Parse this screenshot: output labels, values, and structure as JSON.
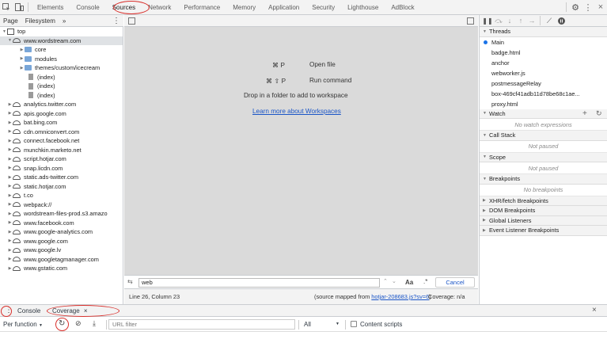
{
  "main_tabs": [
    "Elements",
    "Console",
    "Sources",
    "Network",
    "Performance",
    "Memory",
    "Application",
    "Security",
    "Lighthouse",
    "AdBlock"
  ],
  "navigator": {
    "tabs": [
      "Page",
      "Filesystem",
      "»"
    ],
    "tree": [
      {
        "label": "top",
        "indent": 0,
        "kind": "frame",
        "open": true
      },
      {
        "label": "www.wordstream.com",
        "indent": 1,
        "kind": "cloud",
        "open": true,
        "selected": true
      },
      {
        "label": "core",
        "indent": 2,
        "kind": "folder",
        "open": false
      },
      {
        "label": "modules",
        "indent": 2,
        "kind": "folder",
        "open": false
      },
      {
        "label": "themes/custom/icecream",
        "indent": 2,
        "kind": "folder",
        "open": false
      },
      {
        "label": "(index)",
        "indent": 3,
        "kind": "file"
      },
      {
        "label": "(index)",
        "indent": 3,
        "kind": "file"
      },
      {
        "label": "(index)",
        "indent": 3,
        "kind": "file"
      },
      {
        "label": "analytics.twitter.com",
        "indent": 1,
        "kind": "cloud",
        "open": false
      },
      {
        "label": "apis.google.com",
        "indent": 1,
        "kind": "cloud",
        "open": false
      },
      {
        "label": "bat.bing.com",
        "indent": 1,
        "kind": "cloud",
        "open": false
      },
      {
        "label": "cdn.omniconvert.com",
        "indent": 1,
        "kind": "cloud",
        "open": false
      },
      {
        "label": "connect.facebook.net",
        "indent": 1,
        "kind": "cloud",
        "open": false
      },
      {
        "label": "munchkin.marketo.net",
        "indent": 1,
        "kind": "cloud",
        "open": false
      },
      {
        "label": "script.hotjar.com",
        "indent": 1,
        "kind": "cloud",
        "open": false
      },
      {
        "label": "snap.licdn.com",
        "indent": 1,
        "kind": "cloud",
        "open": false
      },
      {
        "label": "static.ads-twitter.com",
        "indent": 1,
        "kind": "cloud",
        "open": false
      },
      {
        "label": "static.hotjar.com",
        "indent": 1,
        "kind": "cloud",
        "open": false
      },
      {
        "label": "t.co",
        "indent": 1,
        "kind": "cloud",
        "open": false
      },
      {
        "label": "webpack://",
        "indent": 1,
        "kind": "cloud",
        "open": false
      },
      {
        "label": "wordstream-files-prod.s3.amazo",
        "indent": 1,
        "kind": "cloud",
        "open": false
      },
      {
        "label": "www.facebook.com",
        "indent": 1,
        "kind": "cloud",
        "open": false
      },
      {
        "label": "www.google-analytics.com",
        "indent": 1,
        "kind": "cloud",
        "open": false
      },
      {
        "label": "www.google.com",
        "indent": 1,
        "kind": "cloud",
        "open": false
      },
      {
        "label": "www.google.lv",
        "indent": 1,
        "kind": "cloud",
        "open": false
      },
      {
        "label": "www.googletagmanager.com",
        "indent": 1,
        "kind": "cloud",
        "open": false
      },
      {
        "label": "www.gstatic.com",
        "indent": 1,
        "kind": "cloud",
        "open": false
      }
    ]
  },
  "editor": {
    "open_file_keys": "⌘ P",
    "open_file_label": "Open file",
    "run_command_keys": "⌘ ⇧ P",
    "run_command_label": "Run command",
    "drop_folder_text": "Drop in a folder to add to workspace",
    "workspaces_link": "Learn more about Workspaces"
  },
  "search": {
    "value": "web",
    "match_case_label": "Aa",
    "regex_label": ".*",
    "cancel_label": "Cancel"
  },
  "status": {
    "position": "Line 26, Column 23",
    "source_mapped_prefix": "(source mapped from ",
    "source_mapped_link": "hotjar-208683.js?sv=6",
    "source_mapped_suffix": ")",
    "coverage": "Coverage: n/a"
  },
  "debugger": {
    "threads_label": "Threads",
    "threads": [
      {
        "label": "Main",
        "active": true
      },
      {
        "label": "badge.html",
        "active": false
      },
      {
        "label": "anchor",
        "active": false
      },
      {
        "label": "webworker.js",
        "active": false
      },
      {
        "label": "postmessageRelay",
        "active": false
      },
      {
        "label": "box-469cf41adb11d78be68c1ae...",
        "active": false
      },
      {
        "label": "proxy.html",
        "active": false
      }
    ],
    "watch_label": "Watch",
    "watch_empty": "No watch expressions",
    "call_stack_label": "Call Stack",
    "call_stack_empty": "Not paused",
    "scope_label": "Scope",
    "scope_empty": "Not paused",
    "breakpoints_label": "Breakpoints",
    "breakpoints_empty": "No breakpoints",
    "collapsed_sections": [
      "XHR/fetch Breakpoints",
      "DOM Breakpoints",
      "Global Listeners",
      "Event Listener Breakpoints"
    ]
  },
  "drawer": {
    "console_tab": "Console",
    "coverage_tab": "Coverage",
    "close_tab_glyph": "×",
    "close_drawer_glyph": "×"
  },
  "coverage": {
    "per_function_label": "Per function",
    "url_filter_placeholder": "URL filter",
    "type_filter_value": "All",
    "content_scripts_label": "Content scripts"
  },
  "colors": {
    "annotation_red": "#d9302c",
    "link_blue": "#1a55c7",
    "editor_gray": "#dadada",
    "toolbar_gray": "#f3f3f3"
  }
}
